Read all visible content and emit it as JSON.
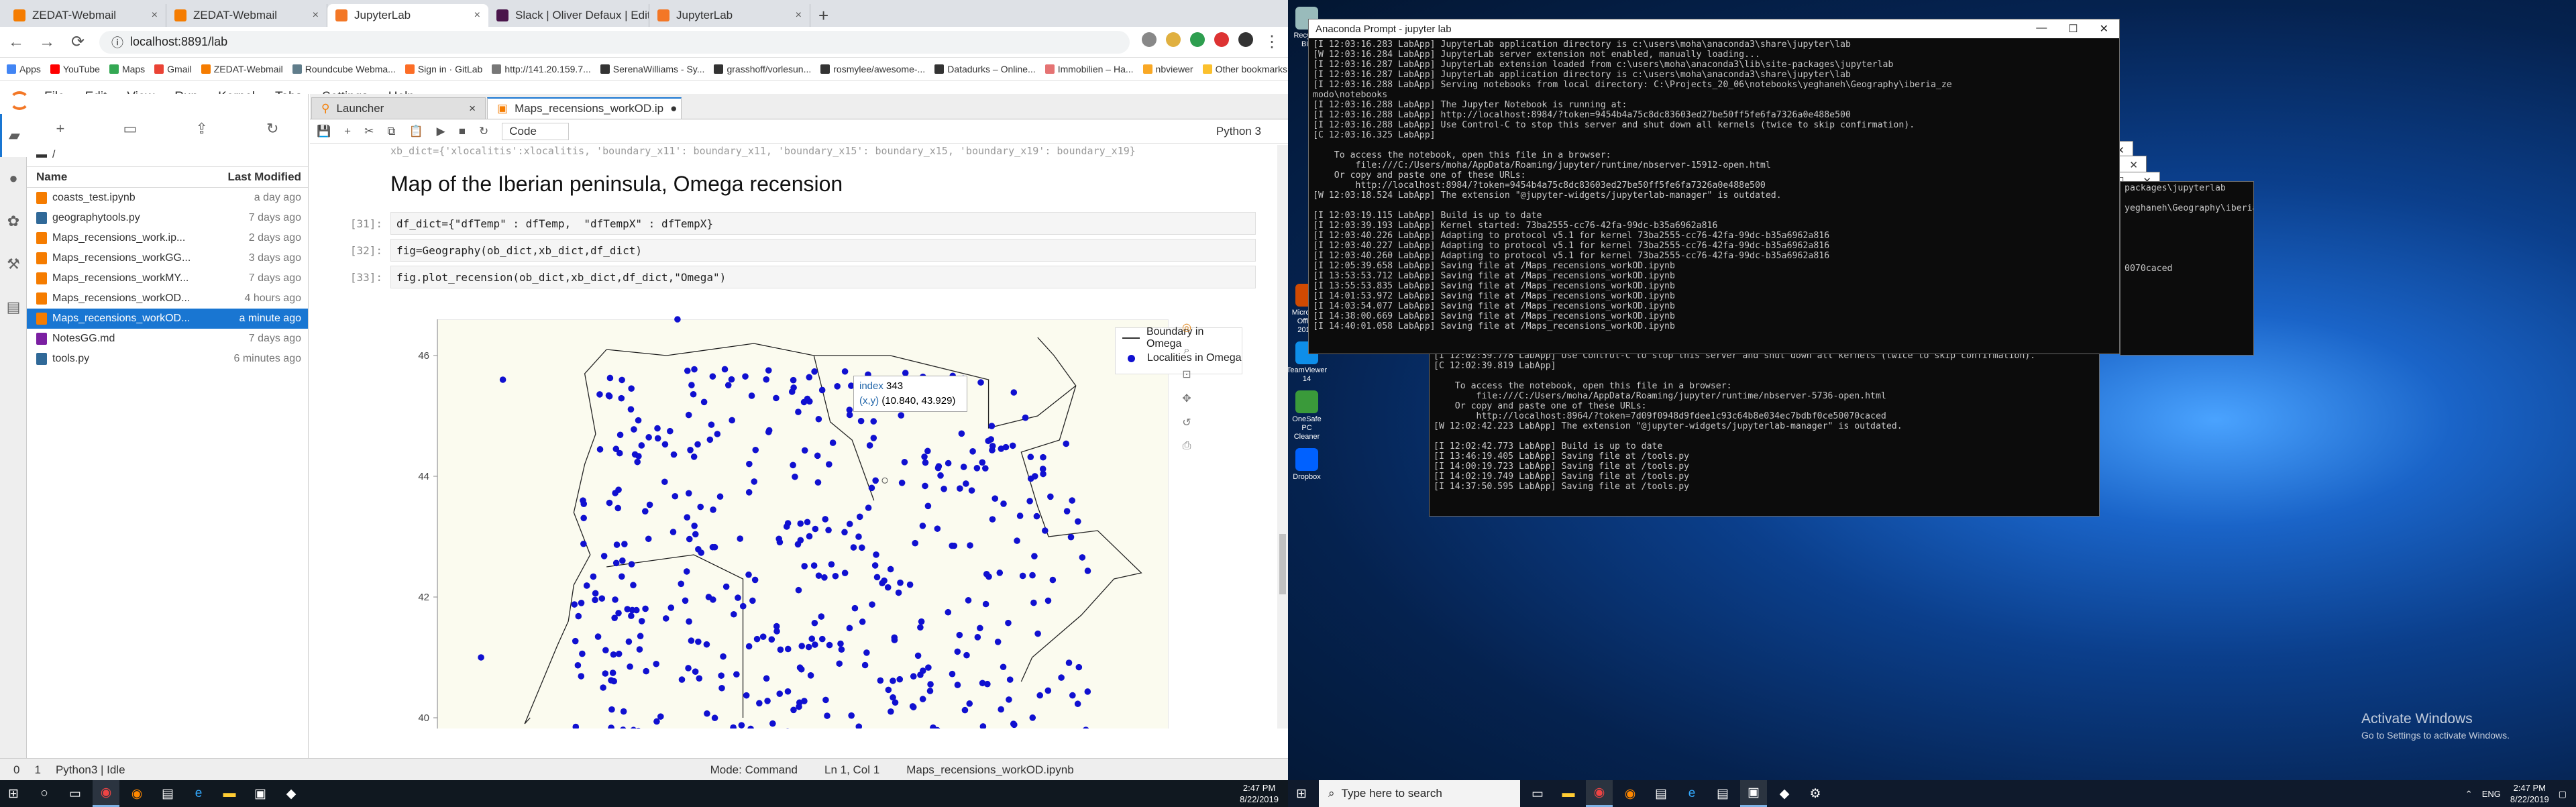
{
  "browser": {
    "tabs": [
      {
        "label": "ZEDAT-Webmail",
        "color": "#f57c00"
      },
      {
        "label": "ZEDAT-Webmail",
        "color": "#f57c00"
      },
      {
        "label": "JupyterLab",
        "color": "#f37726",
        "active": true
      },
      {
        "label": "Slack | Oliver Defaux | EditionTo...",
        "color": "#4a154b"
      },
      {
        "label": "JupyterLab",
        "color": "#f37726"
      }
    ],
    "new_tab": "+",
    "url": "localhost:8891/lab",
    "bookmarks": [
      "Apps",
      "YouTube",
      "Maps",
      "Gmail",
      "ZEDAT-Webmail",
      "Roundcube Webma...",
      "Sign in · GitLab",
      "http://141.20.159.7...",
      "SerenaWilliams - Sy...",
      "grasshoff/vorlesun...",
      "rosmylee/awesome-...",
      "Datadurks – Online...",
      "Immobilien – Ha...",
      "nbviewer",
      "Other bookmarks"
    ]
  },
  "jupyter": {
    "menu": [
      "File",
      "Edit",
      "View",
      "Run",
      "Kernel",
      "Tabs",
      "Settings",
      "Help"
    ],
    "breadcrumb": "/",
    "file_browser": {
      "col_name": "Name",
      "col_modified": "Last Modified",
      "files": [
        {
          "name": "coasts_test.ipynb",
          "modified": "a day ago",
          "color": "#f57c00"
        },
        {
          "name": "geographytools.py",
          "modified": "7 days ago",
          "color": "#306998"
        },
        {
          "name": "Maps_recensions_work.ip...",
          "modified": "2 days ago",
          "color": "#f57c00"
        },
        {
          "name": "Maps_recensions_workGG...",
          "modified": "3 days ago",
          "color": "#f57c00"
        },
        {
          "name": "Maps_recensions_workMY...",
          "modified": "7 days ago",
          "color": "#f57c00"
        },
        {
          "name": "Maps_recensions_workOD...",
          "modified": "4 hours ago",
          "color": "#f57c00"
        },
        {
          "name": "Maps_recensions_workOD...",
          "modified": "a minute ago",
          "color": "#f57c00",
          "selected": true
        },
        {
          "name": "NotesGG.md",
          "modified": "7 days ago",
          "color": "#7b1fa2"
        },
        {
          "name": "tools.py",
          "modified": "6 minutes ago",
          "color": "#306998"
        }
      ]
    },
    "doc_tabs": [
      {
        "label": "Launcher"
      },
      {
        "label": "Maps_recensions_workOD.ip",
        "active": true
      }
    ],
    "toolbar": {
      "cell_type": "Code",
      "kernel": "Python 3"
    },
    "notebook": {
      "cut_code": "xb_dict={'xlocalitis':xlocalitis,  'boundary_x11': boundary_x11,  'boundary_x15': boundary_x15,  'boundary_x19': boundary_x19}",
      "heading": "Map of the Iberian peninsula, Omega recension",
      "cells": [
        {
          "prompt": "[31]:",
          "code": "df_dict={\"dfTemp\" : dfTemp,  \"dfTempX\" : dfTempX}"
        },
        {
          "prompt": "[32]:",
          "code": "fig=Geography(ob_dict,xb_dict,df_dict)"
        },
        {
          "prompt": "[33]:",
          "code": "fig.plot_recension(ob_dict,xb_dict,df_dict,\"Omega\")"
        }
      ]
    },
    "statusbar": {
      "left1": "0",
      "left2": "1",
      "kernel_status": "Python3 | Idle",
      "mode": "Mode: Command",
      "position": "Ln 1, Col 1",
      "file": "Maps_recensions_workOD.ipynb"
    }
  },
  "chart_data": {
    "type": "scatter",
    "ylim": [
      39.6,
      46.6
    ],
    "xlim": [
      -9.8,
      3.6
    ],
    "yticks": [
      40,
      42,
      44,
      46
    ],
    "grid": false,
    "legend_position": "top-right",
    "series": [
      {
        "name": "Boundary in Omega",
        "type": "line",
        "color": "#222222"
      },
      {
        "name": "Localities in Omega",
        "type": "scatter",
        "color": "#1010d0",
        "points_approx": 420
      }
    ],
    "hover": {
      "label1": "index",
      "value1": "343",
      "label2": "(x,y)",
      "value2": "(10.840, 43.929)"
    }
  },
  "desktop": {
    "icons": [
      {
        "label": "Recycle Bin",
        "color": "#9bb"
      },
      {
        "label": "Microsoft Office 201...",
        "color": "#d04a02"
      },
      {
        "label": "TeamViewer 14",
        "color": "#0e8ee9"
      },
      {
        "label": "OneSafe PC Cleaner",
        "color": "#3a9a3a"
      },
      {
        "label": "Dropbox",
        "color": "#0061ff"
      }
    ],
    "activate_title": "Activate Windows",
    "activate_sub": "Go to Settings to activate Windows."
  },
  "terminal_front": {
    "title": "Anaconda Prompt - jupyter lab",
    "text": "[I 12:03:16.283 LabApp] JupyterLab application directory is c:\\users\\moha\\anaconda3\\share\\jupyter\\lab\n[W 12:03:16.284 LabApp] JupyterLab server extension not enabled, manually loading...\n[I 12:03:16.287 LabApp] JupyterLab extension loaded from c:\\users\\moha\\anaconda3\\lib\\site-packages\\jupyterlab\n[I 12:03:16.287 LabApp] JupyterLab application directory is c:\\users\\moha\\anaconda3\\share\\jupyter\\lab\n[I 12:03:16.288 LabApp] Serving notebooks from local directory: C:\\Projects_20_06\\notebooks\\yeghaneh\\Geography\\iberia_ze\nmodo\\notebooks\n[I 12:03:16.288 LabApp] The Jupyter Notebook is running at:\n[I 12:03:16.288 LabApp] http://localhost:8984/?token=9454b4a75c8dc83603ed27be50ff5fe6fa7326a0e488e500\n[I 12:03:16.288 LabApp] Use Control-C to stop this server and shut down all kernels (twice to skip confirmation).\n[C 12:03:16.325 LabApp]\n\n    To access the notebook, open this file in a browser:\n        file:///C:/Users/moha/AppData/Roaming/jupyter/runtime/nbserver-15912-open.html\n    Or copy and paste one of these URLs:\n        http://localhost:8984/?token=9454b4a75c8dc83603ed27be50ff5fe6fa7326a0e488e500\n[W 12:03:18.524 LabApp] The extension \"@jupyter-widgets/jupyterlab-manager\" is outdated.\n\n[I 12:03:19.115 LabApp] Build is up to date\n[I 12:03:39.193 LabApp] Kernel started: 73ba2555-cc76-42fa-99dc-b35a6962a816\n[I 12:03:40.226 LabApp] Adapting to protocol v5.1 for kernel 73ba2555-cc76-42fa-99dc-b35a6962a816\n[I 12:03:40.227 LabApp] Adapting to protocol v5.1 for kernel 73ba2555-cc76-42fa-99dc-b35a6962a816\n[I 12:03:40.260 LabApp] Adapting to protocol v5.1 for kernel 73ba2555-cc76-42fa-99dc-b35a6962a816\n[I 12:05:39.658 LabApp] Saving file at /Maps_recensions_workOD.ipynb\n[I 13:53:53.712 LabApp] Saving file at /Maps_recensions_workOD.ipynb\n[I 13:55:53.835 LabApp] Saving file at /Maps_recensions_workOD.ipynb\n[I 14:01:53.972 LabApp] Saving file at /Maps_recensions_workOD.ipynb\n[I 14:03:54.077 LabApp] Saving file at /Maps_recensions_workOD.ipynb\n[I 14:38:00.669 LabApp] Saving file at /Maps_recensions_workOD.ipynb\n[I 14:40:01.058 LabApp] Saving file at /Maps_recensions_workOD.ipynb"
  },
  "terminal_back": {
    "text": "[I 12:02:39.778 LabApp] Use Control-C to stop this server and shut down all kernels (twice to skip confirmation).\n[C 12:02:39.819 LabApp]\n\n    To access the notebook, open this file in a browser:\n        file:///C:/Users/moha/AppData/Roaming/jupyter/runtime/nbserver-5736-open.html\n    Or copy and paste one of these URLs:\n        http://localhost:8964/?token=7d09f0948d9fdee1c93c64b8e034ec7bdbf0ce50070caced\n[W 12:02:42.223 LabApp] The extension \"@jupyter-widgets/jupyterlab-manager\" is outdated.\n\n[I 12:02:42.773 LabApp] Build is up to date\n[I 13:46:19.405 LabApp] Saving file at /tools.py\n[I 14:00:19.723 LabApp] Saving file at /tools.py\n[I 14:02:19.749 LabApp] Saving file at /tools.py\n[I 14:37:50.595 LabApp] Saving file at /tools.py",
    "side_text": "packages\\jupyterlab\n\nyeghaneh\\Geography\\iberia_ze\n\n\n\n\n\n0070caced"
  },
  "taskbar_left": {
    "time": "2:47 PM",
    "date": "8/22/2019"
  },
  "taskbar_right": {
    "search_placeholder": "Type here to search",
    "time": "2:47 PM",
    "date": "8/22/2019",
    "lang": "ENG"
  }
}
